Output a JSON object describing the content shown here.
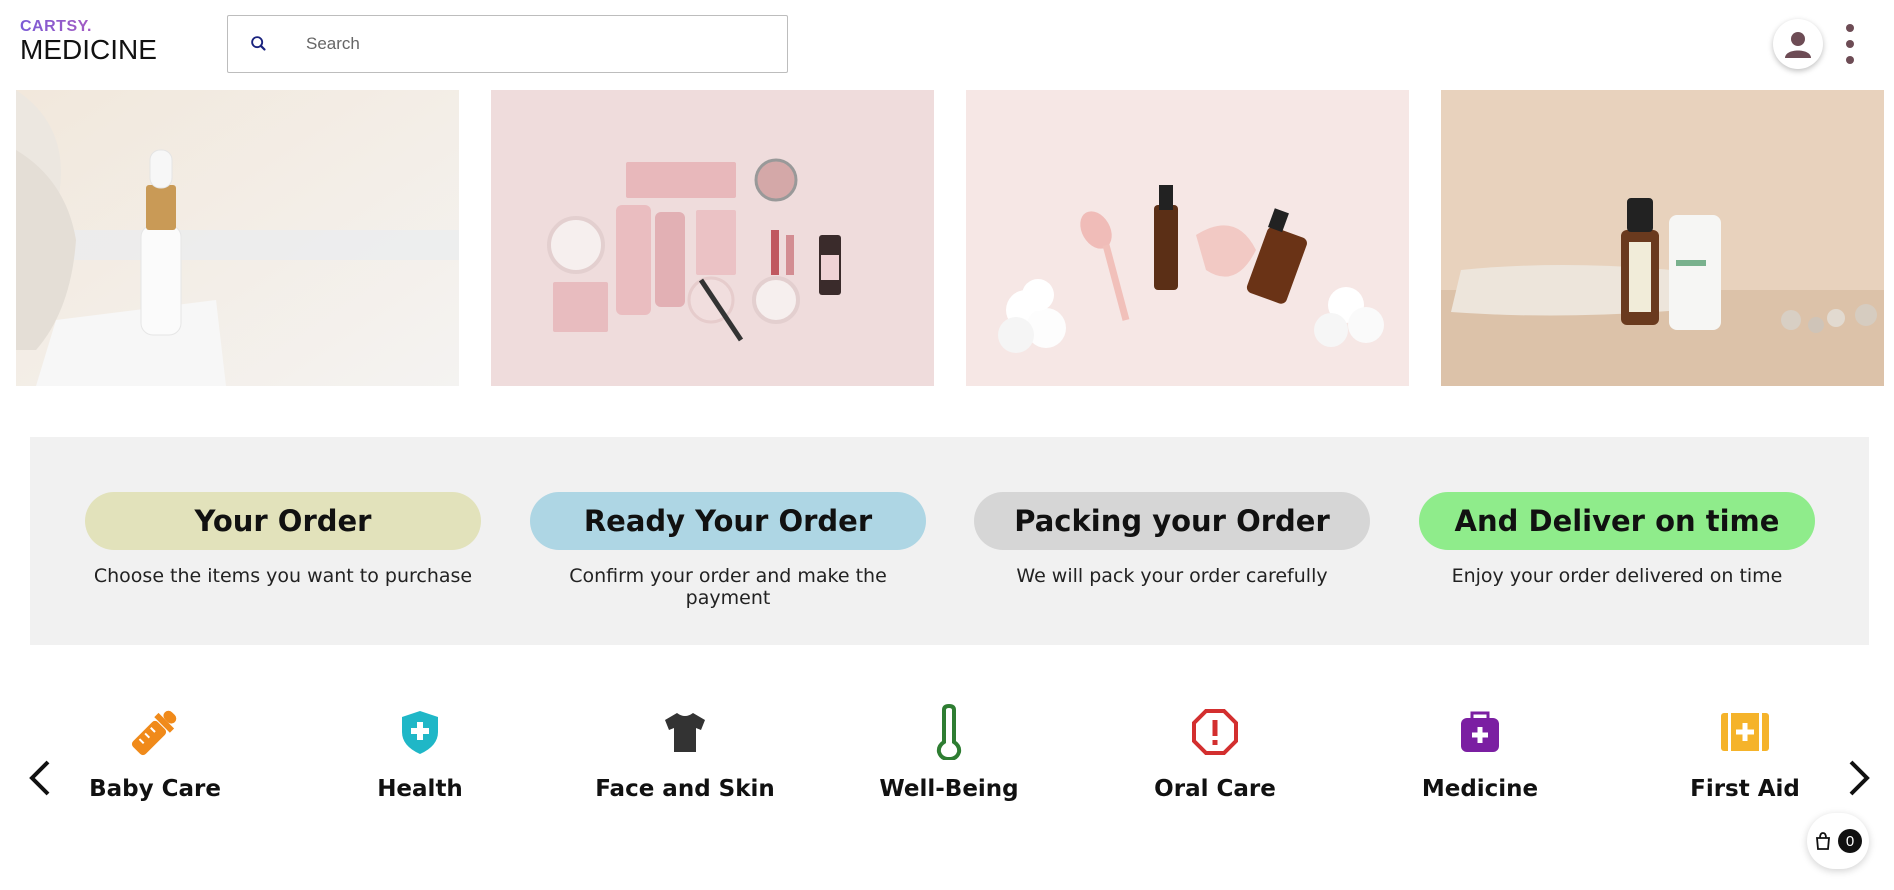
{
  "header": {
    "logo_top": "CARTSY.",
    "logo_main": "MEDICINE",
    "search_placeholder": "Search"
  },
  "steps": [
    {
      "title": "Your Order",
      "desc": "Choose the items you want to purchase",
      "color": "#e2e2bb"
    },
    {
      "title": "Ready Your Order",
      "desc": "Confirm your order and make the payment",
      "color": "#aed6e4"
    },
    {
      "title": "Packing your Order",
      "desc": "We will pack your order carefully",
      "color": "#d6d6d6"
    },
    {
      "title": "And Deliver on time",
      "desc": "Enjoy your order delivered on time",
      "color": "#8fec8b"
    }
  ],
  "categories": [
    {
      "label": "Baby Care",
      "icon": "baby-bottle-icon",
      "color": "#f08a1a"
    },
    {
      "label": "Health",
      "icon": "health-shield-icon",
      "color": "#1fb7c7"
    },
    {
      "label": "Face and Skin",
      "icon": "tshirt-icon",
      "color": "#333333"
    },
    {
      "label": "Well-Being",
      "icon": "thermometer-icon",
      "color": "#2e7d32"
    },
    {
      "label": "Oral Care",
      "icon": "alert-octagon-icon",
      "color": "#d32f2f"
    },
    {
      "label": "Medicine",
      "icon": "medicine-bag-icon",
      "color": "#7b1fa2"
    },
    {
      "label": "First Aid",
      "icon": "first-aid-kit-icon",
      "color": "#f5b32a"
    }
  ],
  "cart": {
    "count": "0"
  }
}
